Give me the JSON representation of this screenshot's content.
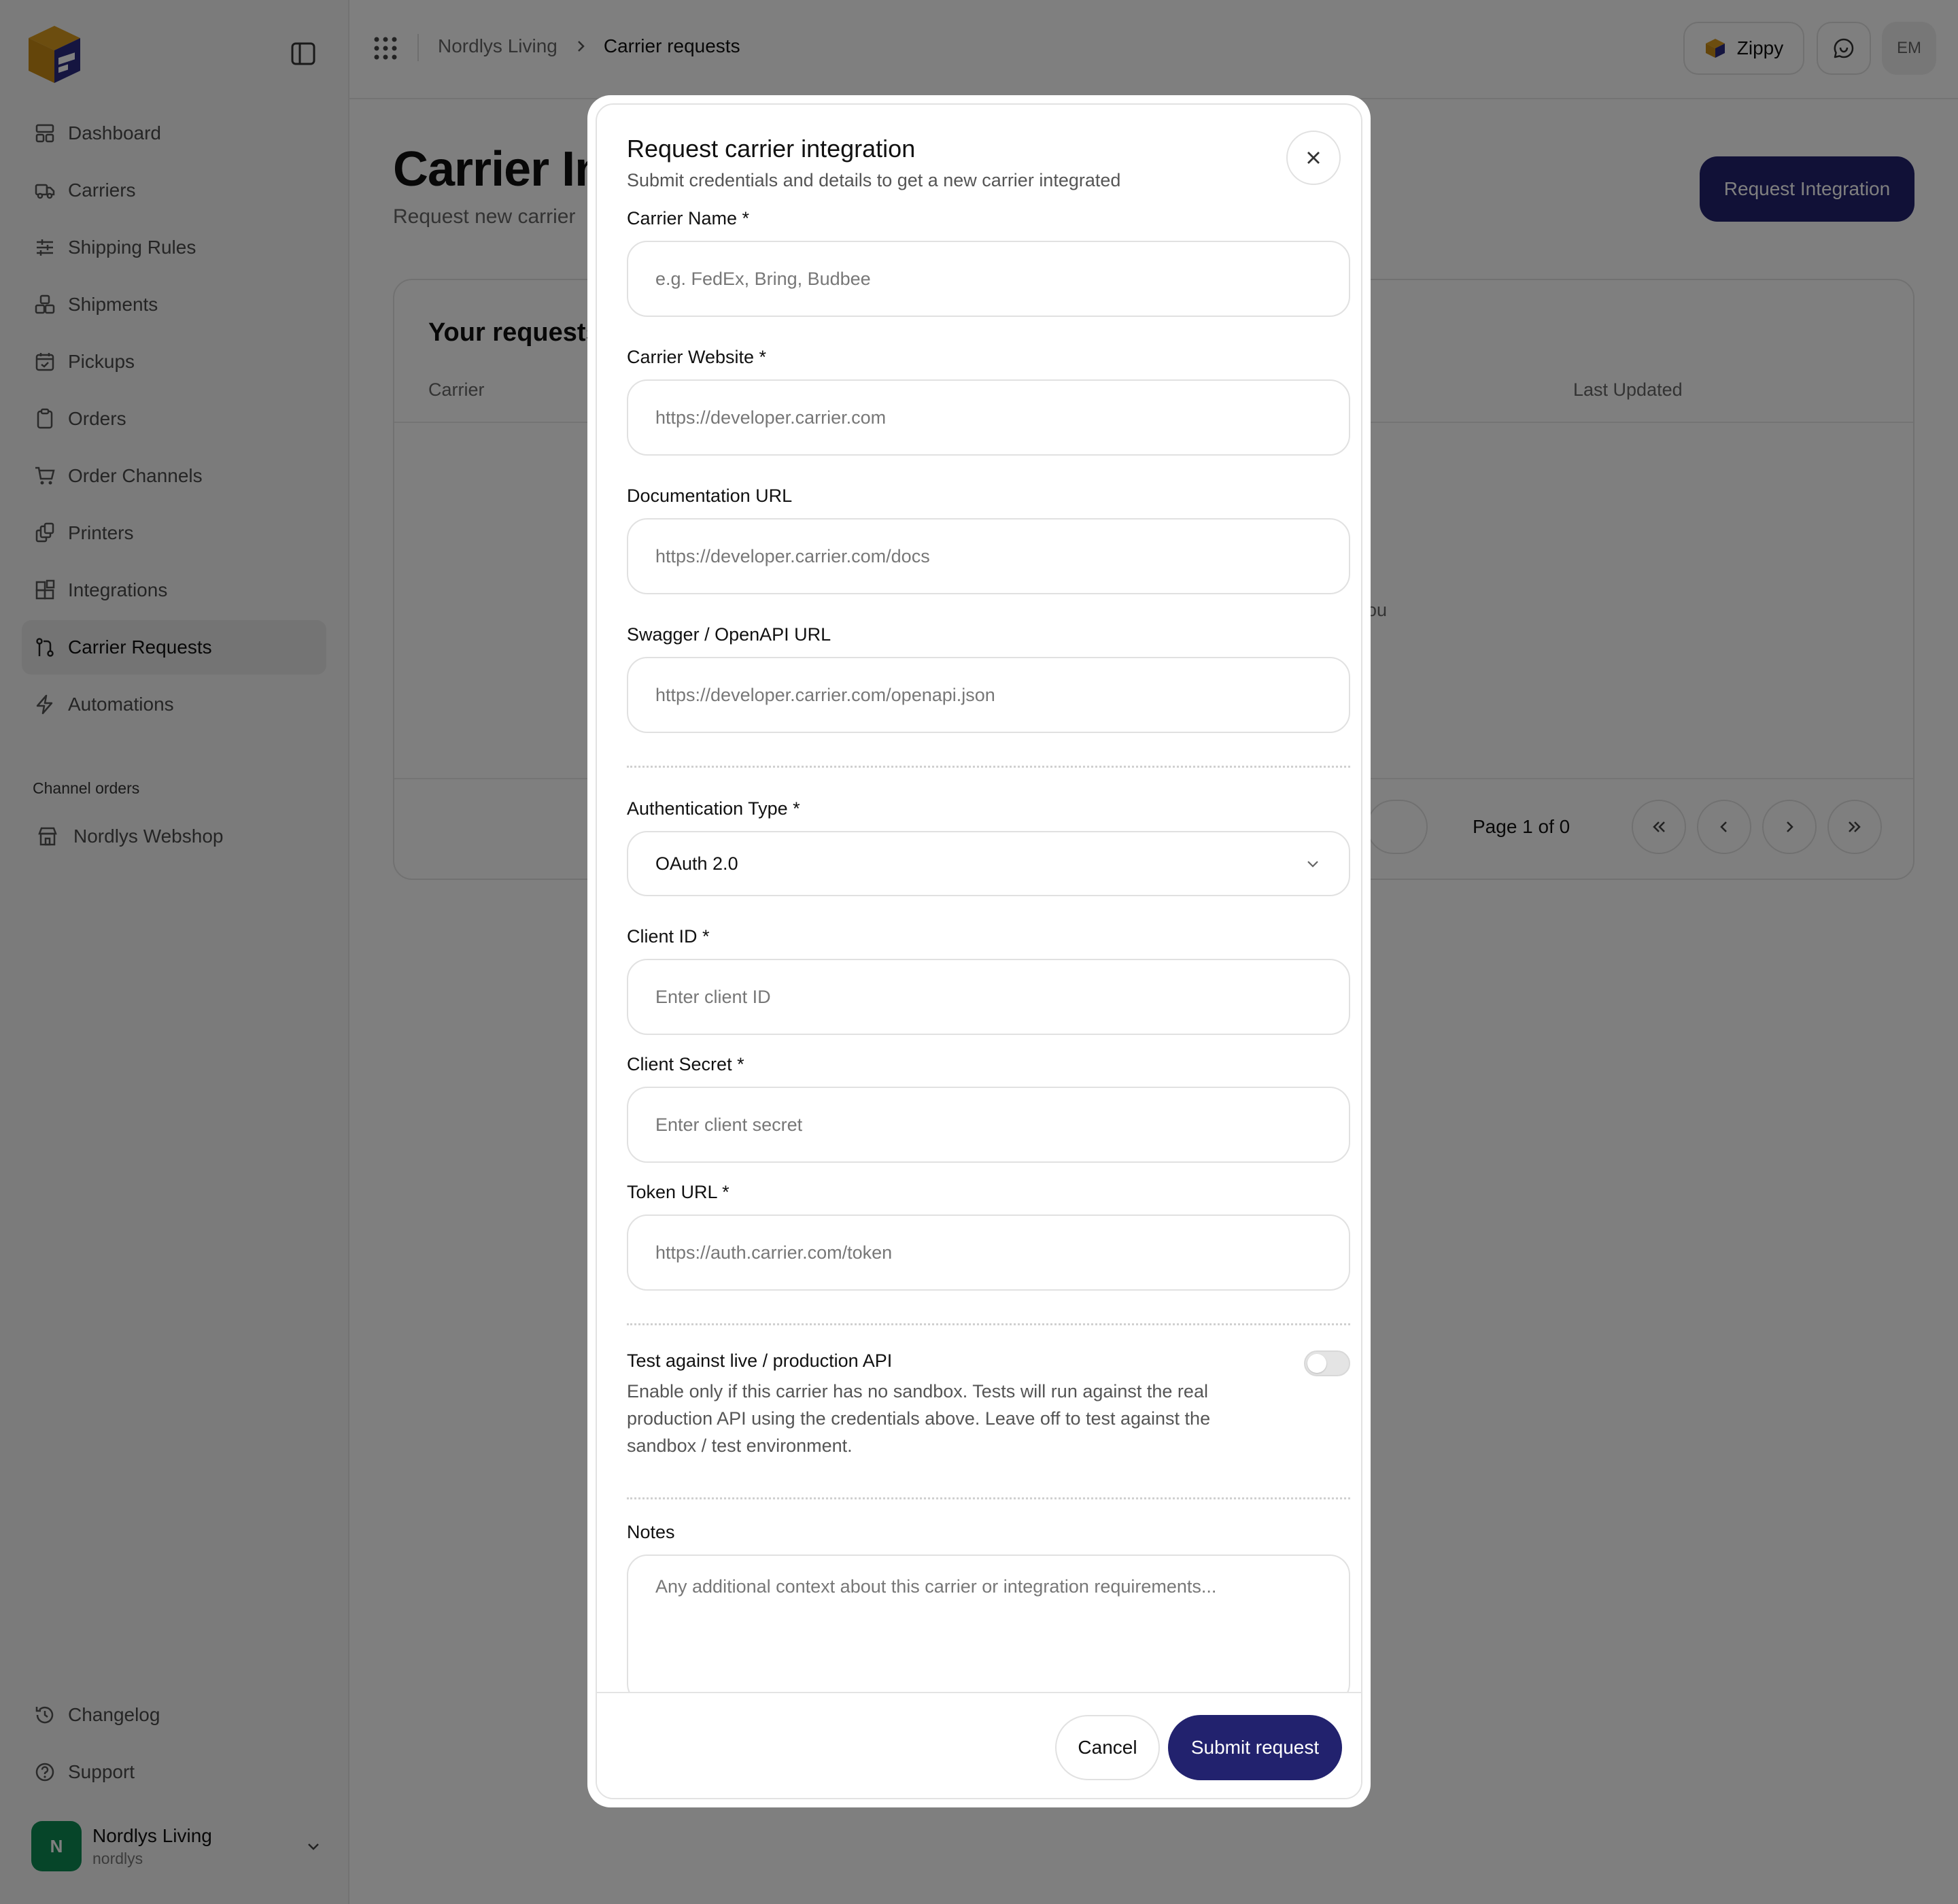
{
  "sidebar": {
    "nav_items": [
      {
        "label": "Dashboard",
        "icon": "dashboard-icon"
      },
      {
        "label": "Carriers",
        "icon": "truck-icon"
      },
      {
        "label": "Shipping Rules",
        "icon": "sliders-icon"
      },
      {
        "label": "Shipments",
        "icon": "boxes-icon"
      },
      {
        "label": "Pickups",
        "icon": "calendar-check-icon"
      },
      {
        "label": "Orders",
        "icon": "clipboard-icon"
      },
      {
        "label": "Order Channels",
        "icon": "cart-icon"
      },
      {
        "label": "Printers",
        "icon": "printer-icon"
      },
      {
        "label": "Integrations",
        "icon": "blocks-icon"
      },
      {
        "label": "Carrier Requests",
        "icon": "git-pull-request-icon",
        "active": true
      },
      {
        "label": "Automations",
        "icon": "zap-icon"
      }
    ],
    "channel_section_label": "Channel orders",
    "channel_item": {
      "label": "Nordlys Webshop",
      "icon": "store-icon"
    },
    "bottom_items": [
      {
        "label": "Changelog",
        "icon": "history-icon"
      },
      {
        "label": "Support",
        "icon": "help-circle-icon"
      }
    ],
    "org": {
      "initial": "N",
      "name": "Nordlys Living",
      "slug": "nordlys"
    }
  },
  "header": {
    "breadcrumb": {
      "parent": "Nordlys Living",
      "current": "Carrier requests"
    },
    "zippy_label": "Zippy",
    "user_initials": "EM"
  },
  "page": {
    "title": "Carrier In",
    "subtitle": "Request new carrier",
    "request_button": "Request Integration",
    "card_title": "Your requests",
    "columns": {
      "carrier": "Carrier",
      "last_updated": "Last Updated"
    },
    "empty_text_fragment": "ou",
    "pagination": {
      "page_info": "Page 1 of 0"
    }
  },
  "modal": {
    "title": "Request carrier integration",
    "description": "Submit credentials and details to get a new carrier integrated",
    "fields": {
      "carrier_name": {
        "label": "Carrier Name *",
        "placeholder": "e.g. FedEx, Bring, Budbee"
      },
      "carrier_website": {
        "label": "Carrier Website *",
        "placeholder": "https://developer.carrier.com"
      },
      "documentation_url": {
        "label": "Documentation URL",
        "placeholder": "https://developer.carrier.com/docs"
      },
      "swagger_url": {
        "label": "Swagger / OpenAPI URL",
        "placeholder": "https://developer.carrier.com/openapi.json"
      },
      "auth_type": {
        "label": "Authentication Type *",
        "value": "OAuth 2.0"
      },
      "client_id": {
        "label": "Client ID *",
        "placeholder": "Enter client ID"
      },
      "client_secret": {
        "label": "Client Secret *",
        "placeholder": "Enter client secret"
      },
      "token_url": {
        "label": "Token URL *",
        "placeholder": "https://auth.carrier.com/token"
      },
      "notes": {
        "label": "Notes",
        "placeholder": "Any additional context about this carrier or integration requirements..."
      }
    },
    "toggle": {
      "title": "Test against live / production API",
      "description": "Enable only if this carrier has no sandbox. Tests will run against the real production API using the credentials above. Leave off to test against the sandbox / test environment.",
      "on": false
    },
    "cancel_label": "Cancel",
    "submit_label": "Submit request"
  },
  "colors": {
    "primary": "#22226e",
    "org_avatar": "#0d8a52",
    "logo_gold": "#d99a1e",
    "logo_navy": "#2a2a80"
  }
}
